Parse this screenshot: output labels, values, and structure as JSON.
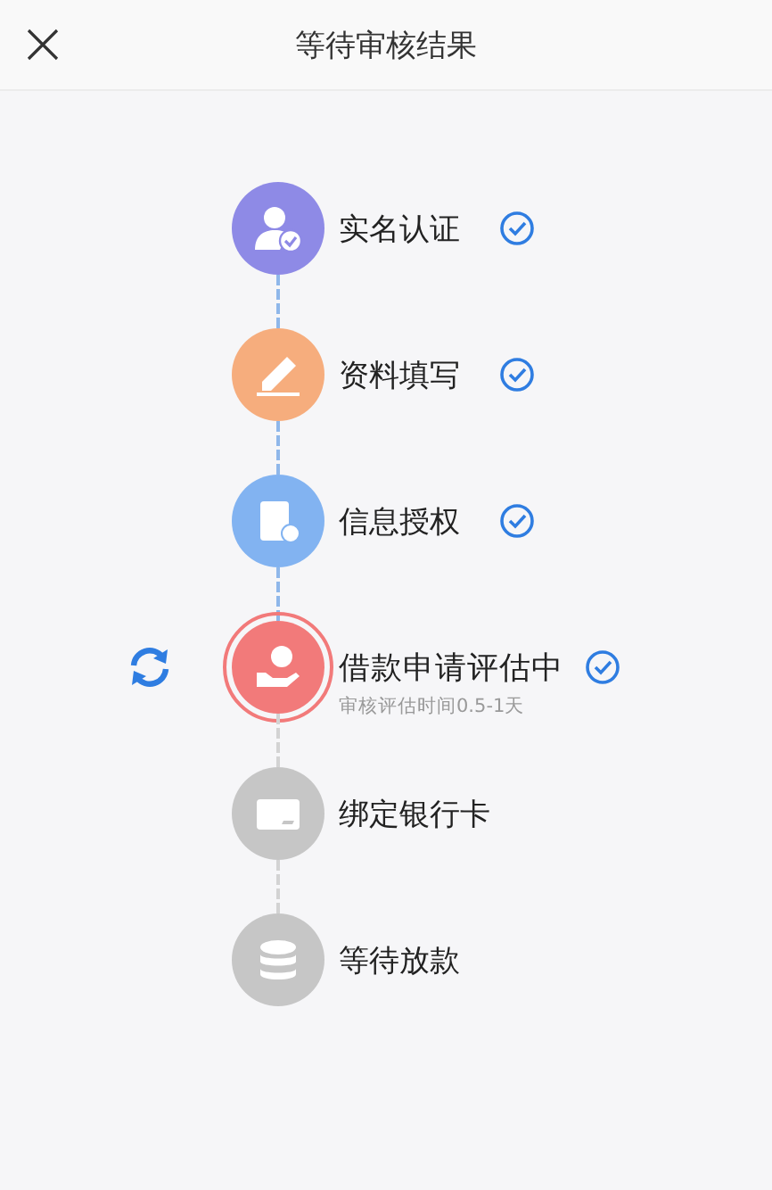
{
  "header": {
    "title": "等待审核结果"
  },
  "steps": [
    {
      "label": "实名认证",
      "kind": "person",
      "current": false,
      "checked": true,
      "color": "#8e8ae6"
    },
    {
      "label": "资料填写",
      "kind": "pencil",
      "current": false,
      "checked": true,
      "color": "#f6ad7d"
    },
    {
      "label": "信息授权",
      "kind": "document",
      "current": false,
      "checked": true,
      "color": "#82b3f1"
    },
    {
      "label": "借款申请评估中",
      "kind": "money",
      "current": true,
      "checked": true,
      "color": "#f27a7a",
      "note": "审核评估时间0.5-1天"
    },
    {
      "label": "绑定银行卡",
      "kind": "card",
      "current": false,
      "checked": false,
      "color": "#c6c6c6"
    },
    {
      "label": "等待放款",
      "kind": "coins",
      "current": false,
      "checked": false,
      "color": "#c6c6c6"
    }
  ]
}
